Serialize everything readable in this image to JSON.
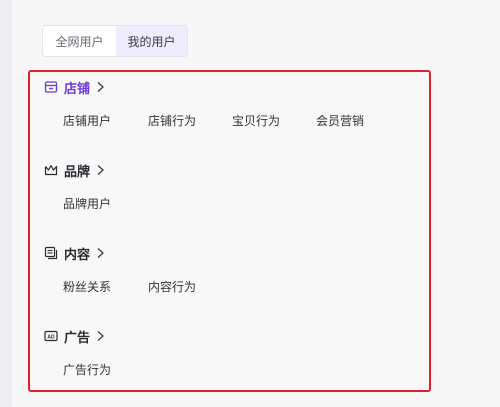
{
  "tabs": [
    {
      "label": "全网用户",
      "active": false
    },
    {
      "label": "我的用户",
      "active": true
    }
  ],
  "sections": [
    {
      "title": "店铺",
      "icon": "store-icon",
      "items": [
        "店铺用户",
        "店铺行为",
        "宝贝行为",
        "会员营销"
      ]
    },
    {
      "title": "品牌",
      "icon": "crown-icon",
      "items": [
        "品牌用户"
      ]
    },
    {
      "title": "内容",
      "icon": "content-icon",
      "items": [
        "粉丝关系",
        "内容行为"
      ]
    },
    {
      "title": "广告",
      "icon": "ad-icon",
      "items": [
        "广告行为"
      ]
    }
  ],
  "colors": {
    "accent": "#6b3cd6",
    "highlight_border": "#e1202a",
    "tab_active_bg": "#f1ecfd"
  }
}
